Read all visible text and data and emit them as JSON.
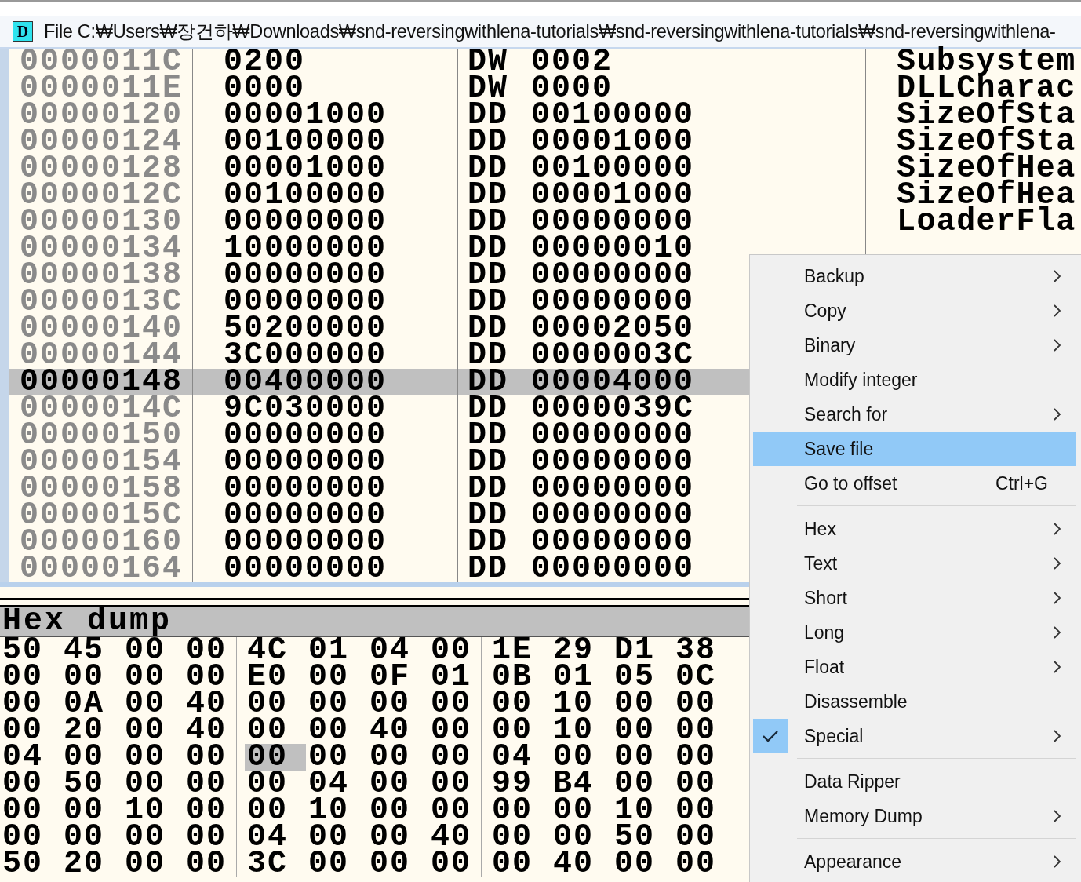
{
  "window": {
    "icon_letter": "D",
    "title": "File C:₩Users₩장건하₩Downloads₩snd-reversingwithlena-tutorials₩snd-reversingwithlena-tutorials₩snd-reversingwithlena-"
  },
  "listing": {
    "rows": [
      {
        "address": "0000011C",
        "hex": "0200",
        "mnemonic": "DW",
        "operand": "0002",
        "comment": "Subsystem",
        "selected": false
      },
      {
        "address": "0000011E",
        "hex": "0000",
        "mnemonic": "DW",
        "operand": "0000",
        "comment": "DLLCharac",
        "selected": false
      },
      {
        "address": "00000120",
        "hex": "00001000",
        "mnemonic": "DD",
        "operand": "00100000",
        "comment": "SizeOfSta",
        "selected": false
      },
      {
        "address": "00000124",
        "hex": "00100000",
        "mnemonic": "DD",
        "operand": "00001000",
        "comment": "SizeOfSta",
        "selected": false
      },
      {
        "address": "00000128",
        "hex": "00001000",
        "mnemonic": "DD",
        "operand": "00100000",
        "comment": "SizeOfHea",
        "selected": false
      },
      {
        "address": "0000012C",
        "hex": "00100000",
        "mnemonic": "DD",
        "operand": "00001000",
        "comment": "SizeOfHea",
        "selected": false
      },
      {
        "address": "00000130",
        "hex": "00000000",
        "mnemonic": "DD",
        "operand": "00000000",
        "comment": "LoaderFla",
        "selected": false
      },
      {
        "address": "00000134",
        "hex": "10000000",
        "mnemonic": "DD",
        "operand": "00000010",
        "selected": false
      },
      {
        "address": "00000138",
        "hex": "00000000",
        "mnemonic": "DD",
        "operand": "00000000",
        "selected": false
      },
      {
        "address": "0000013C",
        "hex": "00000000",
        "mnemonic": "DD",
        "operand": "00000000",
        "selected": false
      },
      {
        "address": "00000140",
        "hex": "50200000",
        "mnemonic": "DD",
        "operand": "00002050",
        "selected": false
      },
      {
        "address": "00000144",
        "hex": "3C000000",
        "mnemonic": "DD",
        "operand": "0000003C",
        "selected": false
      },
      {
        "address": "00000148",
        "hex": "00400000",
        "mnemonic": "DD",
        "operand": "00004000",
        "selected": true
      },
      {
        "address": "0000014C",
        "hex": "9C030000",
        "mnemonic": "DD",
        "operand": "0000039C",
        "selected": false
      },
      {
        "address": "00000150",
        "hex": "00000000",
        "mnemonic": "DD",
        "operand": "00000000",
        "selected": false
      },
      {
        "address": "00000154",
        "hex": "00000000",
        "mnemonic": "DD",
        "operand": "00000000",
        "selected": false
      },
      {
        "address": "00000158",
        "hex": "00000000",
        "mnemonic": "DD",
        "operand": "00000000",
        "selected": false
      },
      {
        "address": "0000015C",
        "hex": "00000000",
        "mnemonic": "DD",
        "operand": "00000000",
        "selected": false
      },
      {
        "address": "00000160",
        "hex": "00000000",
        "mnemonic": "DD",
        "operand": "00000000",
        "selected": false
      },
      {
        "address": "00000164",
        "hex": "00000000",
        "mnemonic": "DD",
        "operand": "00000000",
        "selected": false
      }
    ]
  },
  "hex_dump": {
    "title": "Hex dump",
    "rows": [
      {
        "bytes": [
          {
            "value": "50",
            "selected": false
          },
          {
            "value": "45",
            "selected": false
          },
          {
            "value": "00",
            "selected": false
          },
          {
            "value": "00",
            "selected": false
          },
          {
            "value": "4C",
            "selected": false
          },
          {
            "value": "01",
            "selected": false
          },
          {
            "value": "04",
            "selected": false
          },
          {
            "value": "00",
            "selected": false
          },
          {
            "value": "1E",
            "selected": false
          },
          {
            "value": "29",
            "selected": false
          },
          {
            "value": "D1",
            "selected": false
          },
          {
            "value": "38",
            "selected": false
          }
        ]
      },
      {
        "bytes": [
          {
            "value": "00",
            "selected": false
          },
          {
            "value": "00",
            "selected": false
          },
          {
            "value": "00",
            "selected": false
          },
          {
            "value": "00",
            "selected": false
          },
          {
            "value": "E0",
            "selected": false
          },
          {
            "value": "00",
            "selected": false
          },
          {
            "value": "0F",
            "selected": false
          },
          {
            "value": "01",
            "selected": false
          },
          {
            "value": "0B",
            "selected": false
          },
          {
            "value": "01",
            "selected": false
          },
          {
            "value": "05",
            "selected": false
          },
          {
            "value": "0C",
            "selected": false
          }
        ]
      },
      {
        "bytes": [
          {
            "value": "00",
            "selected": false
          },
          {
            "value": "0A",
            "selected": false
          },
          {
            "value": "00",
            "selected": false
          },
          {
            "value": "40",
            "selected": false
          },
          {
            "value": "00",
            "selected": false
          },
          {
            "value": "00",
            "selected": false
          },
          {
            "value": "00",
            "selected": false
          },
          {
            "value": "00",
            "selected": false
          },
          {
            "value": "00",
            "selected": false
          },
          {
            "value": "10",
            "selected": false
          },
          {
            "value": "00",
            "selected": false
          },
          {
            "value": "00",
            "selected": false
          }
        ]
      },
      {
        "bytes": [
          {
            "value": "00",
            "selected": false
          },
          {
            "value": "20",
            "selected": false
          },
          {
            "value": "00",
            "selected": false
          },
          {
            "value": "40",
            "selected": false
          },
          {
            "value": "00",
            "selected": false
          },
          {
            "value": "00",
            "selected": false
          },
          {
            "value": "40",
            "selected": false
          },
          {
            "value": "00",
            "selected": false
          },
          {
            "value": "00",
            "selected": false
          },
          {
            "value": "10",
            "selected": false
          },
          {
            "value": "00",
            "selected": false
          },
          {
            "value": "00",
            "selected": false
          }
        ]
      },
      {
        "bytes": [
          {
            "value": "04",
            "selected": false
          },
          {
            "value": "00",
            "selected": false
          },
          {
            "value": "00",
            "selected": false
          },
          {
            "value": "00",
            "selected": false
          },
          {
            "value": "00",
            "selected": true
          },
          {
            "value": "00",
            "selected": false
          },
          {
            "value": "00",
            "selected": false
          },
          {
            "value": "00",
            "selected": false
          },
          {
            "value": "04",
            "selected": false
          },
          {
            "value": "00",
            "selected": false
          },
          {
            "value": "00",
            "selected": false
          },
          {
            "value": "00",
            "selected": false
          }
        ]
      },
      {
        "bytes": [
          {
            "value": "00",
            "selected": false
          },
          {
            "value": "50",
            "selected": false
          },
          {
            "value": "00",
            "selected": false
          },
          {
            "value": "00",
            "selected": false
          },
          {
            "value": "00",
            "selected": false
          },
          {
            "value": "04",
            "selected": false
          },
          {
            "value": "00",
            "selected": false
          },
          {
            "value": "00",
            "selected": false
          },
          {
            "value": "99",
            "selected": false
          },
          {
            "value": "B4",
            "selected": false
          },
          {
            "value": "00",
            "selected": false
          },
          {
            "value": "00",
            "selected": false
          }
        ]
      },
      {
        "bytes": [
          {
            "value": "00",
            "selected": false
          },
          {
            "value": "00",
            "selected": false
          },
          {
            "value": "10",
            "selected": false
          },
          {
            "value": "00",
            "selected": false
          },
          {
            "value": "00",
            "selected": false
          },
          {
            "value": "10",
            "selected": false
          },
          {
            "value": "00",
            "selected": false
          },
          {
            "value": "00",
            "selected": false
          },
          {
            "value": "00",
            "selected": false
          },
          {
            "value": "00",
            "selected": false
          },
          {
            "value": "10",
            "selected": false
          },
          {
            "value": "00",
            "selected": false
          }
        ]
      },
      {
        "bytes": [
          {
            "value": "00",
            "selected": false
          },
          {
            "value": "00",
            "selected": false
          },
          {
            "value": "00",
            "selected": false
          },
          {
            "value": "00",
            "selected": false
          },
          {
            "value": "04",
            "selected": false
          },
          {
            "value": "00",
            "selected": false
          },
          {
            "value": "00",
            "selected": false
          },
          {
            "value": "40",
            "selected": false
          },
          {
            "value": "00",
            "selected": false
          },
          {
            "value": "00",
            "selected": false
          },
          {
            "value": "50",
            "selected": false
          },
          {
            "value": "00",
            "selected": false
          }
        ]
      },
      {
        "bytes": [
          {
            "value": "50",
            "selected": false
          },
          {
            "value": "20",
            "selected": false
          },
          {
            "value": "00",
            "selected": false
          },
          {
            "value": "00",
            "selected": false
          },
          {
            "value": "3C",
            "selected": false
          },
          {
            "value": "00",
            "selected": false
          },
          {
            "value": "00",
            "selected": false
          },
          {
            "value": "00",
            "selected": false
          },
          {
            "value": "00",
            "selected": false
          },
          {
            "value": "40",
            "selected": false
          },
          {
            "value": "00",
            "selected": false
          },
          {
            "value": "00",
            "selected": false
          }
        ]
      }
    ]
  },
  "context_menu": {
    "items": [
      {
        "kind": "item",
        "label": "Backup",
        "submenu": true,
        "checked": false,
        "selected": false
      },
      {
        "kind": "item",
        "label": "Copy",
        "submenu": true,
        "checked": false,
        "selected": false
      },
      {
        "kind": "item",
        "label": "Binary",
        "submenu": true,
        "checked": false,
        "selected": false
      },
      {
        "kind": "item",
        "label": "Modify integer",
        "submenu": false,
        "checked": false,
        "selected": false
      },
      {
        "kind": "item",
        "label": "Search for",
        "submenu": true,
        "checked": false,
        "selected": false
      },
      {
        "kind": "item",
        "label": "Save file",
        "submenu": false,
        "checked": false,
        "selected": true
      },
      {
        "kind": "item",
        "label": "Go to offset",
        "shortcut": "Ctrl+G",
        "submenu": false,
        "checked": false,
        "selected": false
      },
      {
        "kind": "separator"
      },
      {
        "kind": "item",
        "label": "Hex",
        "submenu": true,
        "checked": false,
        "selected": false
      },
      {
        "kind": "item",
        "label": "Text",
        "submenu": true,
        "checked": false,
        "selected": false
      },
      {
        "kind": "item",
        "label": "Short",
        "submenu": true,
        "checked": false,
        "selected": false
      },
      {
        "kind": "item",
        "label": "Long",
        "submenu": true,
        "checked": false,
        "selected": false
      },
      {
        "kind": "item",
        "label": "Float",
        "submenu": true,
        "checked": false,
        "selected": false
      },
      {
        "kind": "item",
        "label": "Disassemble",
        "submenu": false,
        "checked": false,
        "selected": false
      },
      {
        "kind": "item",
        "label": "Special",
        "submenu": true,
        "checked": true,
        "selected": false
      },
      {
        "kind": "separator"
      },
      {
        "kind": "item",
        "label": "Data Ripper",
        "submenu": false,
        "checked": false,
        "selected": false
      },
      {
        "kind": "item",
        "label": "Memory Dump",
        "submenu": true,
        "checked": false,
        "selected": false
      },
      {
        "kind": "separator"
      },
      {
        "kind": "item",
        "label": "Appearance",
        "submenu": true,
        "checked": false,
        "selected": false
      }
    ]
  }
}
